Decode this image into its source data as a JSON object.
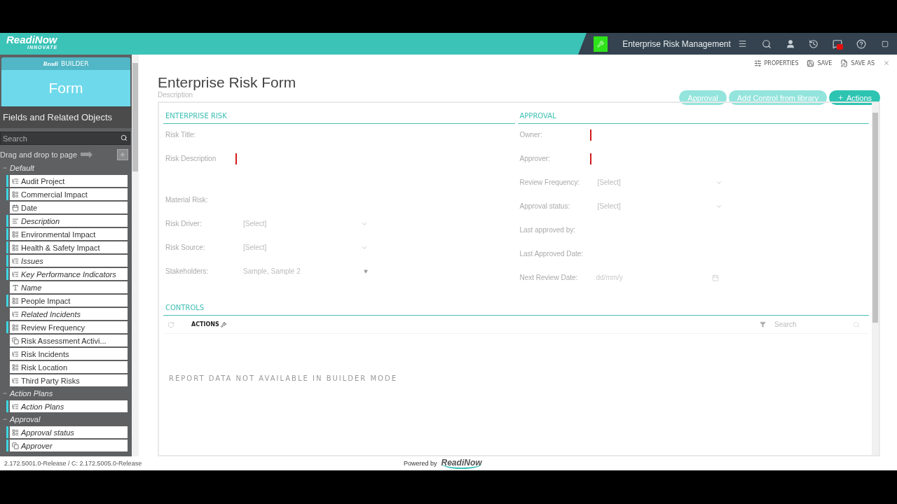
{
  "app_bar": {
    "logo": "ReadiNow",
    "logo_sub": "INNOVATE",
    "app_name": "Enterprise Risk Management"
  },
  "builder": {
    "brand": "Readi",
    "brand_suffix": "BUILDER",
    "mode": "Form",
    "panel_title": "Fields and Related Objects",
    "search": {
      "placeholder": "Search"
    },
    "hint": "Drag and drop to page",
    "groups": [
      {
        "name": "Default",
        "expanded": true,
        "items": [
          {
            "label": "Audit Project",
            "kind": "relationship",
            "on_form": true,
            "italic": false
          },
          {
            "label": "Commercial Impact",
            "kind": "choice",
            "on_form": true,
            "italic": false
          },
          {
            "label": "Date",
            "kind": "date",
            "on_form": false,
            "italic": false
          },
          {
            "label": "Description",
            "kind": "text",
            "on_form": true,
            "italic": true
          },
          {
            "label": "Environmental Impact",
            "kind": "choice",
            "on_form": true,
            "italic": false
          },
          {
            "label": "Health & Safety Impact",
            "kind": "choice",
            "on_form": true,
            "italic": false
          },
          {
            "label": "Issues",
            "kind": "relationship",
            "on_form": true,
            "italic": true
          },
          {
            "label": "Key Performance Indicators",
            "kind": "relationship",
            "on_form": true,
            "italic": true
          },
          {
            "label": "Name",
            "kind": "name",
            "on_form": false,
            "italic": true
          },
          {
            "label": "People Impact",
            "kind": "choice",
            "on_form": true,
            "italic": false
          },
          {
            "label": "Related Incidents",
            "kind": "relationship",
            "on_form": false,
            "italic": true
          },
          {
            "label": "Review Frequency",
            "kind": "choice",
            "on_form": true,
            "italic": false
          },
          {
            "label": "Risk Assessment Activi...",
            "kind": "lookup",
            "on_form": false,
            "italic": false
          },
          {
            "label": "Risk Incidents",
            "kind": "relationship",
            "on_form": false,
            "italic": false
          },
          {
            "label": "Risk Location",
            "kind": "choice",
            "on_form": false,
            "italic": false
          },
          {
            "label": "Third Party Risks",
            "kind": "relationship",
            "on_form": false,
            "italic": false
          }
        ]
      },
      {
        "name": "Action Plans",
        "expanded": true,
        "items": [
          {
            "label": "Action Plans",
            "kind": "relationship",
            "on_form": true,
            "italic": true
          }
        ]
      },
      {
        "name": "Approval",
        "expanded": true,
        "items": [
          {
            "label": "Approval status",
            "kind": "choice",
            "on_form": true,
            "italic": true
          },
          {
            "label": "Approver",
            "kind": "lookup",
            "on_form": true,
            "italic": true
          }
        ]
      }
    ]
  },
  "toolbar": [
    {
      "label": "PROPERTIES",
      "kind": "properties"
    },
    {
      "label": "SAVE",
      "kind": "save"
    },
    {
      "label": "SAVE AS",
      "kind": "save_as"
    }
  ],
  "form": {
    "title": "Enterprise Risk Form",
    "description": {
      "placeholder": "Description"
    },
    "buttons": [
      {
        "label": "Approval",
        "disabled": true,
        "kind": "plain"
      },
      {
        "label": "Add Control from library",
        "disabled": true,
        "kind": "plain"
      },
      {
        "label": "Actions",
        "disabled": false,
        "kind": "add"
      }
    ],
    "sections": [
      {
        "title": "ENTERPRISE RISK",
        "fields": [
          {
            "label": "Risk Title:",
            "kind": "text",
            "required": false
          },
          {
            "label": "Risk Description",
            "kind": "multiline",
            "required": true
          },
          {
            "label": "Material Risk:",
            "kind": "checkbox",
            "required": false
          },
          {
            "label": "Risk Driver:",
            "kind": "select",
            "value": "[Select]",
            "required": false
          },
          {
            "label": "Risk Source:",
            "kind": "select",
            "value": "[Select]",
            "required": false
          },
          {
            "label": "Stakeholders:",
            "kind": "multiselect",
            "value": "Sample, Sample 2",
            "required": false
          }
        ]
      },
      {
        "title": "APPROVAL",
        "fields": [
          {
            "label": "Owner:",
            "kind": "lookup",
            "required": true
          },
          {
            "label": "Approver:",
            "kind": "lookup",
            "required": true
          },
          {
            "label": "Review Frequency:",
            "kind": "select",
            "value": "[Select]",
            "required": false
          },
          {
            "label": "Approval status:",
            "kind": "select",
            "value": "[Select]",
            "required": false
          },
          {
            "label": "Last approved by:",
            "kind": "lookup",
            "required": false
          },
          {
            "label": "Last Approved Date:",
            "kind": "text",
            "required": false
          },
          {
            "label": "Next Review Date:",
            "kind": "date",
            "placeholder": "dd/mm/y",
            "required": false
          }
        ]
      }
    ],
    "controls": {
      "title": "CONTROLS",
      "actions": "ACTIONS",
      "search": {
        "placeholder": "Search"
      },
      "message": "REPORT DATA NOT AVAILABLE IN BUILDER MODE"
    }
  },
  "footer": {
    "version": "2.172.5001.0-Release / C: 2.172.5005.0-Release",
    "powered_by": "Powered by",
    "brand": "ReadiNow"
  }
}
